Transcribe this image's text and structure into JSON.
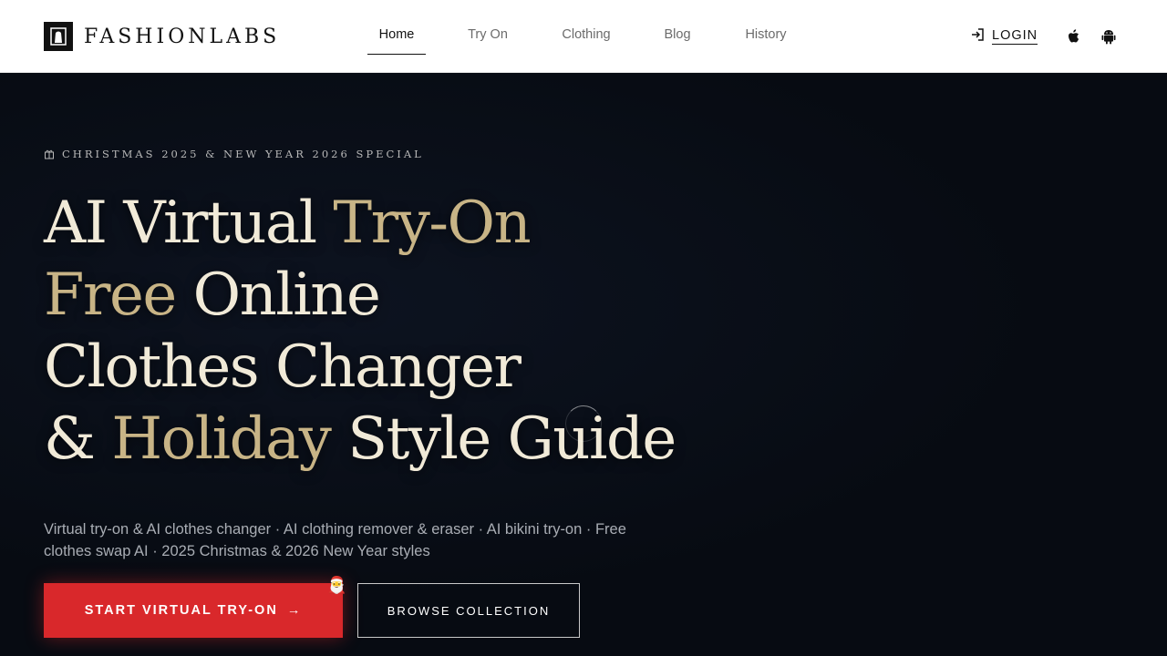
{
  "header": {
    "logo_text": "FASHIONLABS",
    "nav": [
      {
        "label": "Home",
        "active": true
      },
      {
        "label": "Try On",
        "active": false
      },
      {
        "label": "Clothing",
        "active": false
      },
      {
        "label": "Blog",
        "active": false
      },
      {
        "label": "History",
        "active": false
      }
    ],
    "login_label": "LOGIN",
    "login_icon": "login-icon",
    "apps": [
      "apple-icon",
      "android-icon"
    ]
  },
  "hero": {
    "eyebrow": "CHRISTMAS 2025 & NEW YEAR 2026 SPECIAL",
    "eyebrow_icon": "gift-icon",
    "headline": {
      "line1_a": "AI Virtual ",
      "line1_b": "Try-On",
      "line2_a": "Free",
      "line2_b": " Online",
      "line3": "Clothes Changer",
      "line4_a": "& ",
      "line4_b": "Holiday",
      "line4_c": " Style Guide"
    },
    "subtitle": "Virtual try-on & AI clothes changer · AI clothing remover & eraser · AI bikini try-on · Free clothes swap AI · 2025 Christmas & 2026 New Year styles",
    "primary_button": "START VIRTUAL TRY-ON",
    "primary_arrow": "→",
    "santa": "🎅",
    "secondary_button": "BROWSE COLLECTION"
  },
  "colors": {
    "accent": "#d9282b",
    "gold": "#c8b486",
    "headline": "#f1ead8",
    "background": "#070b12"
  }
}
